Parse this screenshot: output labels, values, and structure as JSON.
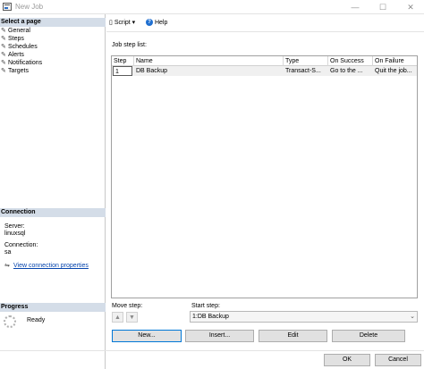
{
  "window": {
    "title": "New Job",
    "minimize": "—",
    "maximize": "☐",
    "close": "✕"
  },
  "sidebar": {
    "select_page_header": "Select a page",
    "pages": [
      {
        "label": "General"
      },
      {
        "label": "Steps"
      },
      {
        "label": "Schedules"
      },
      {
        "label": "Alerts"
      },
      {
        "label": "Notifications"
      },
      {
        "label": "Targets"
      }
    ],
    "connection_header": "Connection",
    "server_label": "Server:",
    "server_value": "linuxsql",
    "connection_label": "Connection:",
    "connection_value": "sa",
    "view_connection_link": "View connection properties",
    "progress_header": "Progress",
    "progress_status": "Ready"
  },
  "toolbar": {
    "script_label": "Script",
    "help_label": "Help"
  },
  "steps": {
    "list_label": "Job step list:",
    "columns": [
      "Step",
      "Name",
      "Type",
      "On Success",
      "On Failure"
    ],
    "rows": [
      {
        "step": "1",
        "name": "DB Backup",
        "type": "Transact-S...",
        "on_success": "Go to the ...",
        "on_failure": "Quit the job..."
      }
    ],
    "move_step_label": "Move step:",
    "start_step_label": "Start step:",
    "start_step_value": "1:DB Backup",
    "buttons": {
      "new": "New...",
      "insert": "Insert...",
      "edit": "Edit",
      "delete": "Delete"
    }
  },
  "footer": {
    "ok": "OK",
    "cancel": "Cancel"
  },
  "icons": {
    "wrench": "wrench-icon",
    "script": "script-icon",
    "help": "help-icon",
    "connection": "connection-icon",
    "spinner": "spinner-icon"
  },
  "colors": {
    "section_header_bg": "#d4dde8",
    "link": "#0645ad",
    "focus_border": "#0078d7"
  }
}
